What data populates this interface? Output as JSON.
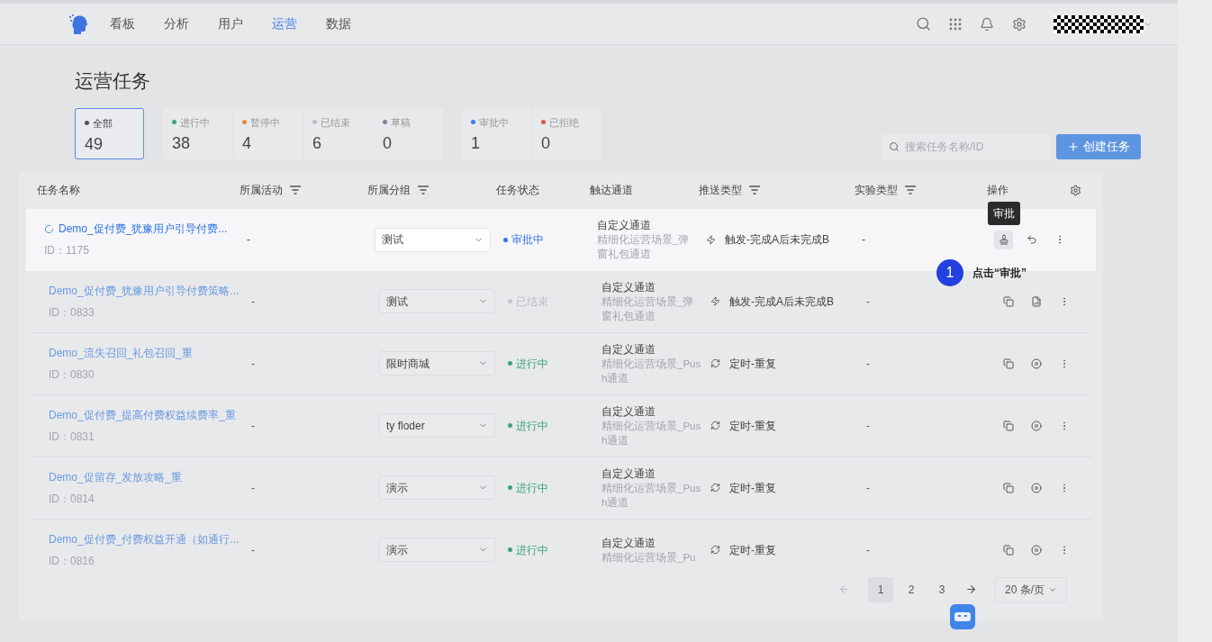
{
  "nav": {
    "items": [
      {
        "label": "看板",
        "selected": false
      },
      {
        "label": "分析",
        "selected": false
      },
      {
        "label": "用户",
        "selected": false
      },
      {
        "label": "运营",
        "selected": true
      },
      {
        "label": "数据",
        "selected": false
      }
    ]
  },
  "page_title": "运营任务",
  "stat_groups": [
    [
      {
        "label": "全部",
        "value": "49",
        "color": "#555555",
        "selected": true
      }
    ],
    [
      {
        "label": "进行中",
        "value": "38",
        "color": "#3aa57a",
        "selected": false
      },
      {
        "label": "暂停中",
        "value": "4",
        "color": "#e8893a",
        "selected": false
      },
      {
        "label": "已结束",
        "value": "6",
        "color": "#b9bcc2",
        "selected": false
      },
      {
        "label": "草稿",
        "value": "0",
        "color": "#7d8294",
        "selected": false
      }
    ],
    [
      {
        "label": "审批中",
        "value": "1",
        "color": "#3c7ee8",
        "selected": false
      },
      {
        "label": "已拒绝",
        "value": "0",
        "color": "#e0574a",
        "selected": false
      }
    ]
  ],
  "search": {
    "placeholder": "搜索任务名称/ID"
  },
  "create_button": "创建任务",
  "table": {
    "columns": [
      {
        "label": "任务名称",
        "filter": false
      },
      {
        "label": "所属活动",
        "filter": true
      },
      {
        "label": "所属分组",
        "filter": true
      },
      {
        "label": "任务状态",
        "filter": false
      },
      {
        "label": "触达通道",
        "filter": false
      },
      {
        "label": "推送类型",
        "filter": true
      },
      {
        "label": "实验类型",
        "filter": true
      },
      {
        "label": "操作",
        "filter": false
      }
    ],
    "rows": [
      {
        "name": "Demo_促付费_犹豫用户引导付费...",
        "loading": true,
        "id": "ID：1175",
        "activity": "-",
        "group": "测试",
        "status": {
          "kind": "approving",
          "label": "审批中"
        },
        "channel": "自定义通道",
        "channel_detail": "精细化运营场景_弹窗礼包通道",
        "push": {
          "kind": "trigger",
          "label": "触发-完成A后未完成B"
        },
        "experiment": "-",
        "actions": [
          {
            "kind": "approve"
          },
          {
            "kind": "revoke"
          },
          {
            "kind": "more"
          }
        ],
        "highlighted": true
      },
      {
        "name": "Demo_促付费_犹豫用户引导付费策略...",
        "loading": false,
        "id": "ID：0833",
        "activity": "-",
        "group": "测试",
        "status": {
          "kind": "ended",
          "label": "已结束"
        },
        "channel": "自定义通道",
        "channel_detail": "精细化运营场景_弹窗礼包通道",
        "push": {
          "kind": "trigger",
          "label": "触发-完成A后未完成B"
        },
        "experiment": "-",
        "actions": [
          {
            "kind": "copy"
          },
          {
            "kind": "report"
          },
          {
            "kind": "more"
          }
        ],
        "highlighted": false
      },
      {
        "name": "Demo_流失召回_礼包召回_重",
        "loading": false,
        "id": "ID：0830",
        "activity": "-",
        "group": "限时商城",
        "status": {
          "kind": "running",
          "label": "进行中"
        },
        "channel": "自定义通道",
        "channel_detail": "精细化运营场景_Push通道",
        "push": {
          "kind": "repeat",
          "label": "定时-重复"
        },
        "experiment": "-",
        "actions": [
          {
            "kind": "copy"
          },
          {
            "kind": "pause"
          },
          {
            "kind": "more"
          }
        ],
        "highlighted": false
      },
      {
        "name": "Demo_促付费_提高付费权益续费率_重",
        "loading": false,
        "id": "ID：0831",
        "activity": "-",
        "group": "ty floder",
        "status": {
          "kind": "running",
          "label": "进行中"
        },
        "channel": "自定义通道",
        "channel_detail": "精细化运营场景_Push通道",
        "push": {
          "kind": "repeat",
          "label": "定时-重复"
        },
        "experiment": "-",
        "actions": [
          {
            "kind": "copy"
          },
          {
            "kind": "pause"
          },
          {
            "kind": "more"
          }
        ],
        "highlighted": false
      },
      {
        "name": "Demo_促留存_发放攻略_重",
        "loading": false,
        "id": "ID：0814",
        "activity": "-",
        "group": "演示",
        "status": {
          "kind": "running",
          "label": "进行中"
        },
        "channel": "自定义通道",
        "channel_detail": "精细化运营场景_Push通道",
        "push": {
          "kind": "repeat",
          "label": "定时-重复"
        },
        "experiment": "-",
        "actions": [
          {
            "kind": "copy"
          },
          {
            "kind": "pause"
          },
          {
            "kind": "more"
          }
        ],
        "highlighted": false
      },
      {
        "name": "Demo_促付费_付费权益开通（如通行...",
        "loading": false,
        "id": "ID：0816",
        "activity": "-",
        "group": "演示",
        "status": {
          "kind": "running",
          "label": "进行中"
        },
        "channel": "自定义通道",
        "channel_detail": "精细化运营场景_Pu",
        "push": {
          "kind": "repeat",
          "label": "定时-重复"
        },
        "experiment": "-",
        "actions": [
          {
            "kind": "copy"
          },
          {
            "kind": "pause"
          },
          {
            "kind": "more"
          }
        ],
        "highlighted": false
      }
    ]
  },
  "tooltip": "审批",
  "guide_step": {
    "number": "1",
    "text": "点击“审批”"
  },
  "pagination": {
    "pages": [
      {
        "label": "1",
        "selected": true
      },
      {
        "label": "2",
        "selected": false
      },
      {
        "label": "3",
        "selected": false
      }
    ],
    "page_size": "20 条/页"
  }
}
